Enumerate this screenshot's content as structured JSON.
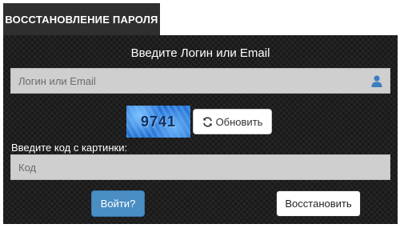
{
  "tab": {
    "title": "ВОССТАНОВЛЕНИЕ ПАРОЛЯ"
  },
  "form": {
    "heading": "Введите Логин или Email",
    "login_input": {
      "placeholder": "Логин или Email",
      "value": ""
    },
    "captcha": {
      "text": "9741",
      "refresh_label": "Обновить",
      "refresh_icon": "refresh-icon"
    },
    "code_label": "Введите код с картинки:",
    "code_input": {
      "placeholder": "Код",
      "value": ""
    },
    "login_button": "Войти?",
    "restore_button": "Восстановить"
  },
  "colors": {
    "panel": "#1f1f1f",
    "tab": "#2f2f2f",
    "input_bg": "#cfcfcf",
    "login_button": "#4a8ec3",
    "user_icon": "#3a7ec0"
  }
}
